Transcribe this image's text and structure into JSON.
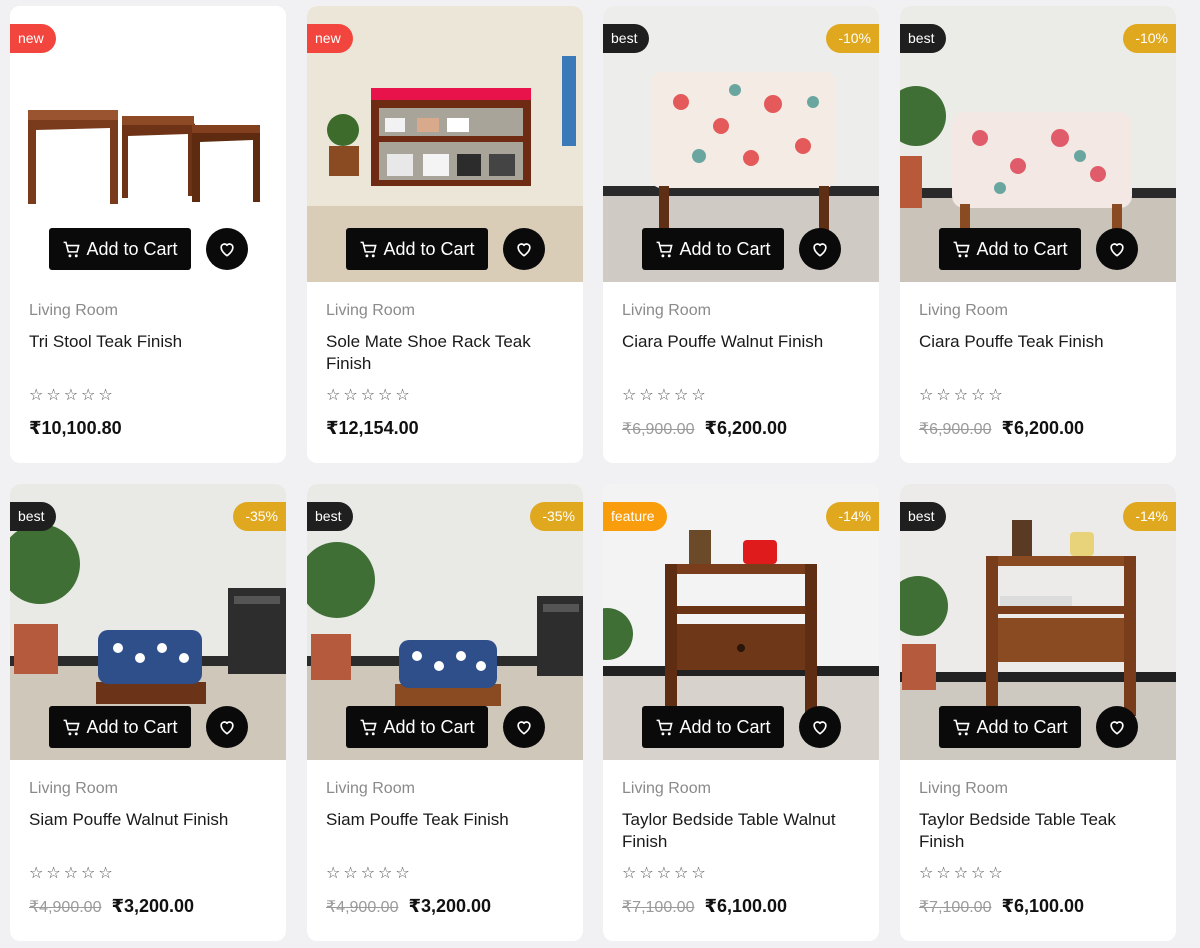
{
  "colors": {
    "new": "#f2453d",
    "best": "#1f1f1f",
    "feature": "#f99d0c",
    "discount": "#e0a81e"
  },
  "icons": {
    "cart": "cart-icon",
    "wishlist": "heart-icon",
    "rating": "star-outline-icon"
  },
  "products": [
    {
      "badge": "new",
      "badge_type": "new",
      "discount": "",
      "category": "Living Room",
      "title": "Tri Stool Teak Finish",
      "old_price": "",
      "price": "₹10,100.80",
      "cart_label": "Add to Cart",
      "rating": 0
    },
    {
      "badge": "new",
      "badge_type": "new",
      "discount": "",
      "category": "Living Room",
      "title": "Sole Mate Shoe Rack Teak Finish",
      "old_price": "",
      "price": "₹12,154.00",
      "cart_label": "Add to Cart",
      "rating": 0
    },
    {
      "badge": "best",
      "badge_type": "best",
      "discount": "-10%",
      "category": "Living Room",
      "title": "Ciara Pouffe Walnut Finish",
      "old_price": "₹6,900.00",
      "price": "₹6,200.00",
      "cart_label": "Add to Cart",
      "rating": 0
    },
    {
      "badge": "best",
      "badge_type": "best",
      "discount": "-10%",
      "category": "Living Room",
      "title": "Ciara Pouffe Teak Finish",
      "old_price": "₹6,900.00",
      "price": "₹6,200.00",
      "cart_label": "Add to Cart",
      "rating": 0
    },
    {
      "badge": "best",
      "badge_type": "best",
      "discount": "-35%",
      "category": "Living Room",
      "title": "Siam Pouffe Walnut Finish",
      "old_price": "₹4,900.00",
      "price": "₹3,200.00",
      "cart_label": "Add to Cart",
      "rating": 0
    },
    {
      "badge": "best",
      "badge_type": "best",
      "discount": "-35%",
      "category": "Living Room",
      "title": "Siam Pouffe Teak Finish",
      "old_price": "₹4,900.00",
      "price": "₹3,200.00",
      "cart_label": "Add to Cart",
      "rating": 0
    },
    {
      "badge": "feature",
      "badge_type": "feature",
      "discount": "-14%",
      "category": "Living Room",
      "title": "Taylor Bedside Table Walnut Finish",
      "old_price": "₹7,100.00",
      "price": "₹6,100.00",
      "cart_label": "Add to Cart",
      "rating": 0
    },
    {
      "badge": "best",
      "badge_type": "best",
      "discount": "-14%",
      "category": "Living Room",
      "title": "Taylor Bedside Table Teak Finish",
      "old_price": "₹7,100.00",
      "price": "₹6,100.00",
      "cart_label": "Add to Cart",
      "rating": 0
    }
  ]
}
